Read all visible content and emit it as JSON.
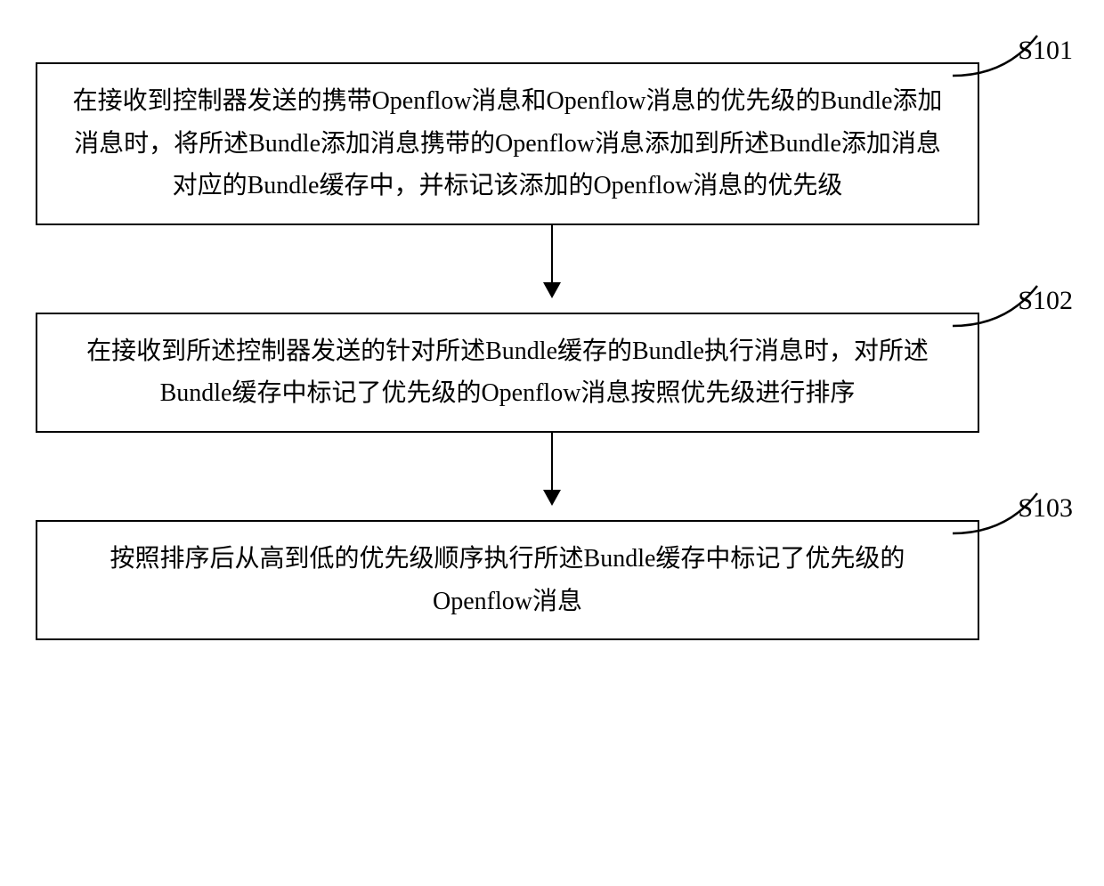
{
  "chart_data": {
    "type": "flowchart",
    "direction": "top-to-bottom",
    "nodes": [
      {
        "id": "S101",
        "label": "S101",
        "text": "在接收到控制器发送的携带Openflow消息和Openflow消息的优先级的Bundle添加消息时，将所述Bundle添加消息携带的Openflow消息添加到所述Bundle添加消息对应的Bundle缓存中，并标记该添加的Openflow消息的优先级"
      },
      {
        "id": "S102",
        "label": "S102",
        "text": "在接收到所述控制器发送的针对所述Bundle缓存的Bundle执行消息时，对所述Bundle缓存中标记了优先级的Openflow消息按照优先级进行排序"
      },
      {
        "id": "S103",
        "label": "S103",
        "text": "按照排序后从高到低的优先级顺序执行所述Bundle缓存中标记了优先级的Openflow消息"
      }
    ],
    "edges": [
      {
        "from": "S101",
        "to": "S102"
      },
      {
        "from": "S102",
        "to": "S103"
      }
    ]
  },
  "steps": {
    "s101": {
      "label": "S101",
      "text": "在接收到控制器发送的携带Openflow消息和Openflow消息的优先级的Bundle添加消息时，将所述Bundle添加消息携带的Openflow消息添加到所述Bundle添加消息对应的Bundle缓存中，并标记该添加的Openflow消息的优先级"
    },
    "s102": {
      "label": "S102",
      "text": "在接收到所述控制器发送的针对所述Bundle缓存的Bundle执行消息时，对所述Bundle缓存中标记了优先级的Openflow消息按照优先级进行排序"
    },
    "s103": {
      "label": "S103",
      "text": "按照排序后从高到低的优先级顺序执行所述Bundle缓存中标记了优先级的Openflow消息"
    }
  }
}
